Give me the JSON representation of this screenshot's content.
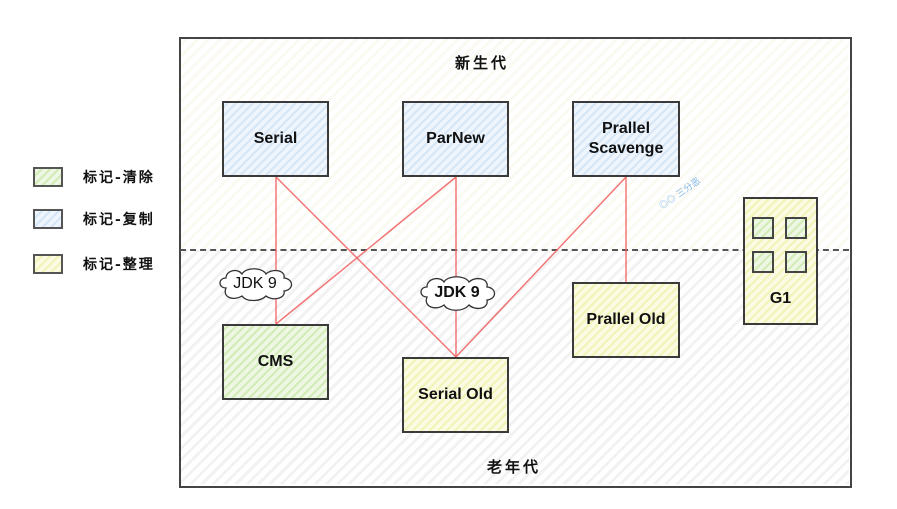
{
  "zones": {
    "young": {
      "title": "新生代"
    },
    "old": {
      "title": "老年代"
    }
  },
  "legend": [
    {
      "label": "标记-清除",
      "color": "green"
    },
    {
      "label": "标记-复制",
      "color": "blue"
    },
    {
      "label": "标记-整理",
      "color": "yellow"
    }
  ],
  "collectors": {
    "serial": {
      "label": "Serial",
      "generation": "young",
      "algorithm": "标记-复制"
    },
    "parnew": {
      "label": "ParNew",
      "generation": "young",
      "algorithm": "标记-复制"
    },
    "parallel_scavenge": {
      "label": "Prallel Scavenge",
      "line1": "Prallel",
      "line2": "Scavenge",
      "generation": "young",
      "algorithm": "标记-复制"
    },
    "cms": {
      "label": "CMS",
      "generation": "old",
      "algorithm": "标记-清除"
    },
    "serial_old": {
      "label": "Serial Old",
      "generation": "old",
      "algorithm": "标记-整理"
    },
    "parallel_old": {
      "label": "Prallel Old",
      "generation": "old",
      "algorithm": "标记-整理"
    },
    "g1": {
      "label": "G1",
      "generation": "both",
      "algorithm": "标记-整理"
    }
  },
  "connections": [
    {
      "from": "Serial",
      "to": "CMS",
      "note": "JDK 9"
    },
    {
      "from": "Serial",
      "to": "Serial Old"
    },
    {
      "from": "ParNew",
      "to": "CMS"
    },
    {
      "from": "ParNew",
      "to": "Serial Old",
      "note": "JDK 9"
    },
    {
      "from": "Prallel Scavenge",
      "to": "Serial Old"
    },
    {
      "from": "Prallel Scavenge",
      "to": "Prallel Old"
    }
  ],
  "annotations": {
    "jdk9_left": "JDK 9",
    "jdk9_center": "JDK 9"
  },
  "watermark": "三分恶",
  "colors": {
    "connection": "#f06060",
    "border": "#3a3a3a",
    "green": "#d2ebb7",
    "blue": "#d6e6f7",
    "yellow": "#f2f3b6"
  }
}
